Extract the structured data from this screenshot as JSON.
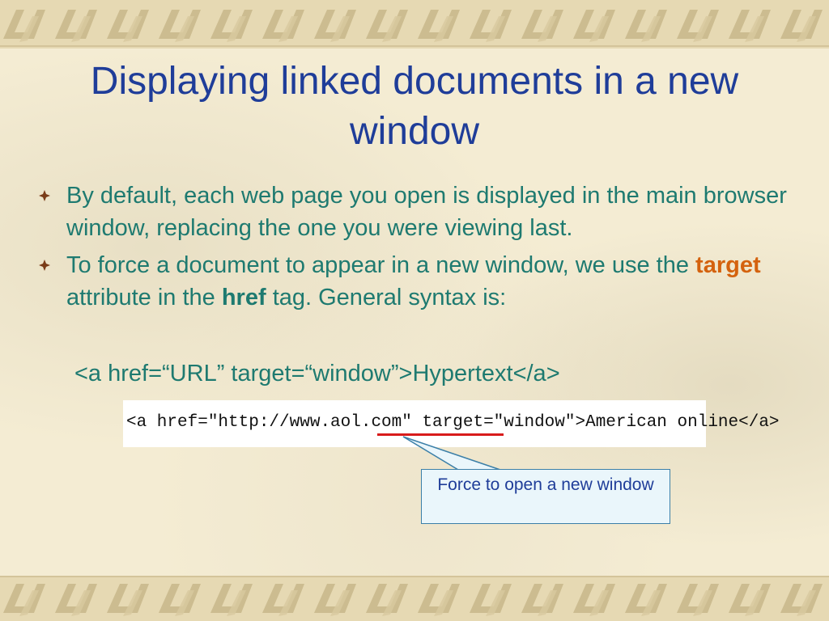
{
  "slide": {
    "title": "Displaying linked documents in a new window",
    "bullets": [
      {
        "text": "By default, each web page you open is displayed in the main browser window, replacing the one you were viewing last."
      },
      {
        "text_before": "To force a document to appear in a new window, we use the ",
        "keyword1": "target",
        "text_middle": " attribute in the ",
        "keyword2": "href",
        "text_after": " tag. General syntax is:"
      }
    ],
    "syntax_example": "<a href=“URL” target=“window”>Hypertext</a>",
    "code_example": "<a href=\"http://www.aol.com\" target=\"window\">American online</a>",
    "callout": "Force to open a new window",
    "colors": {
      "title": "#1f3d99",
      "body_text": "#1e7a70",
      "keyword_highlight": "#d4620e",
      "underline": "#d81b1b",
      "callout_border": "#3b7fa8",
      "callout_fill": "#eaf6fb"
    },
    "icons": {
      "bullet": "four-petal-diamond-icon",
      "border": "greek-key-border-pattern"
    }
  }
}
